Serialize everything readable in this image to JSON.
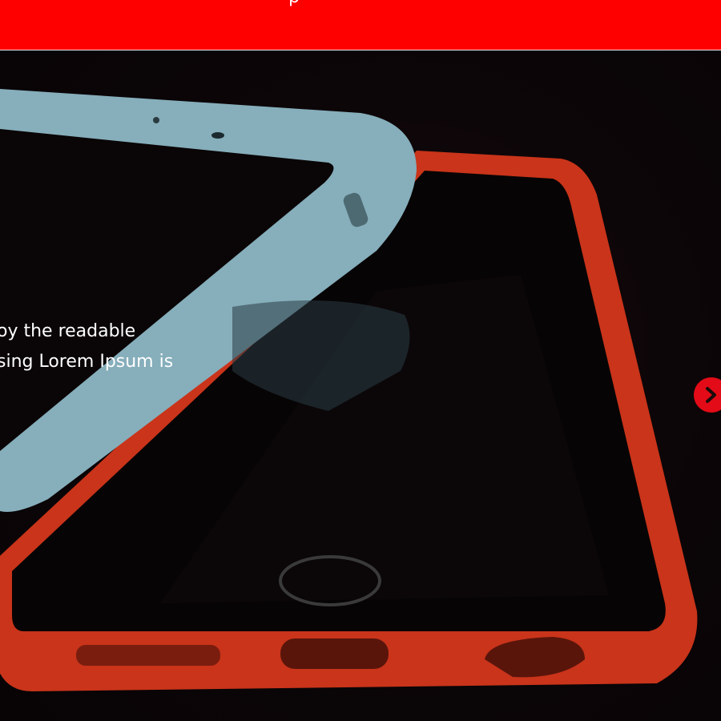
{
  "header": {
    "cut_text": "p"
  },
  "hero": {
    "text_line1": "oy the readable",
    "text_line2": "sing Lorem Ipsum is"
  },
  "carousel": {
    "next_icon": "chevron-right-icon"
  },
  "colors": {
    "header_bg": "#fe0000",
    "arrow_bg": "#e30b17",
    "phone_orange": "#d9381c",
    "phone_blue": "#8fb7c4"
  }
}
